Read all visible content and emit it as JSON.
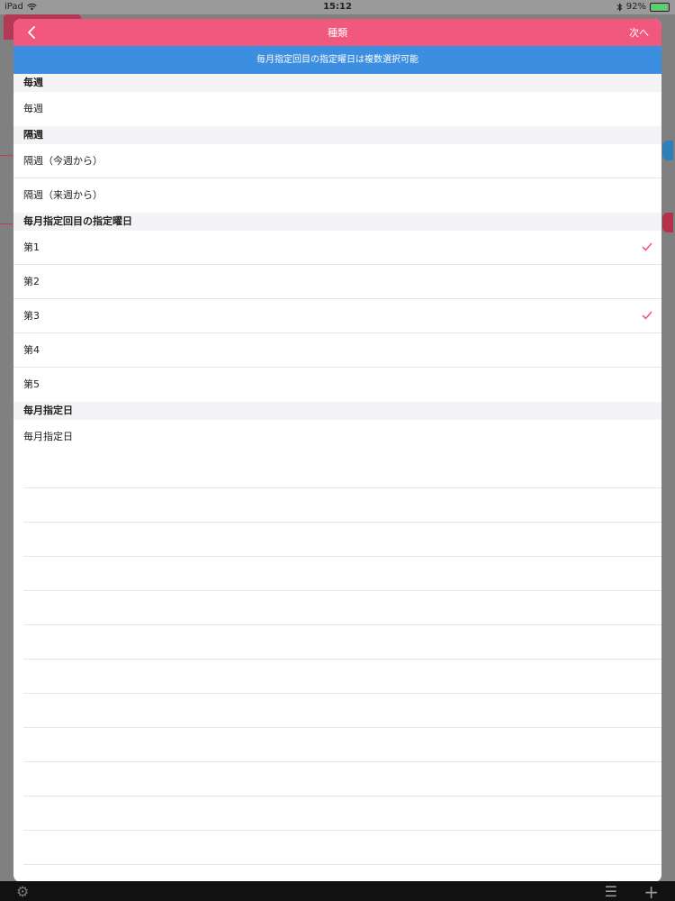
{
  "status_bar": {
    "device": "iPad",
    "time": "15:12",
    "battery": "92%"
  },
  "nav": {
    "title": "種類",
    "next_label": "次へ"
  },
  "notice": "毎月指定回目の指定曜日は複数選択可能",
  "sections": [
    {
      "header": "毎週",
      "rows": [
        {
          "label": "毎週",
          "checked": false
        }
      ]
    },
    {
      "header": "隔週",
      "rows": [
        {
          "label": "隔週（今週から）",
          "checked": false
        },
        {
          "label": "隔週（来週から）",
          "checked": false
        }
      ]
    },
    {
      "header": "毎月指定回目の指定曜日",
      "rows": [
        {
          "label": "第1",
          "checked": true
        },
        {
          "label": "第2",
          "checked": false
        },
        {
          "label": "第3",
          "checked": true
        },
        {
          "label": "第4",
          "checked": false
        },
        {
          "label": "第5",
          "checked": false
        }
      ]
    },
    {
      "header": "毎月指定日",
      "rows": [
        {
          "label": "毎月指定日",
          "checked": false
        }
      ]
    }
  ],
  "colors": {
    "nav_bar": "#f0587e",
    "notice_bar": "#3b8ee0",
    "checkmark": "#f0587e"
  },
  "icons": {
    "back": "chevron-left-icon",
    "check": "checkmark-icon",
    "settings": "gear-icon",
    "menu": "list-icon",
    "add": "plus-icon"
  }
}
